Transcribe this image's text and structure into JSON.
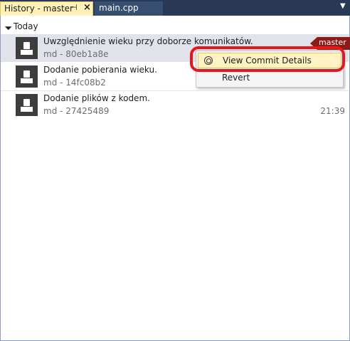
{
  "tabs": [
    {
      "title": "History - master",
      "pin_icon": "pin-icon",
      "close_icon": "close-icon",
      "active": true
    },
    {
      "title": "main.cpp",
      "active": false
    }
  ],
  "group": {
    "label": "Today",
    "icon": "expander-triangle-icon"
  },
  "commits": [
    {
      "message": "Uwzględnienie wieku przy doborze komunikatów.",
      "meta": "md - 80eb1a8e",
      "time": "",
      "branch": "master",
      "selected": true
    },
    {
      "message": "Dodanie pobierania wieku.",
      "meta": "md - 14fc08b2",
      "time": ""
    },
    {
      "message": "Dodanie plików z kodem.",
      "meta": "md - 27425489",
      "time": "21:39"
    }
  ],
  "context_menu": {
    "items": [
      {
        "label": "View Commit Details",
        "icon": "commit-details-icon",
        "highlighted": true
      },
      {
        "label": "Revert",
        "icon": ""
      }
    ]
  },
  "colors": {
    "accent_tab": "#fff1b8",
    "tabbar": "#293955",
    "branch_badge": "#8b1b17",
    "annotation": "#e8151c"
  }
}
